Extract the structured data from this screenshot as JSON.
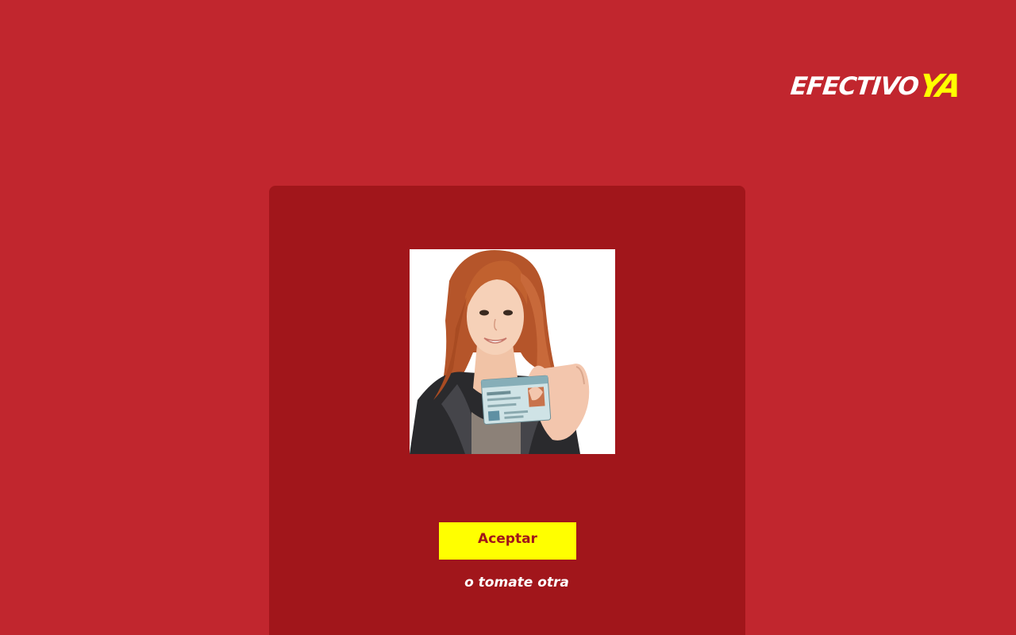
{
  "brand": {
    "logo_main": "EFECTIVO",
    "logo_accent": "YA",
    "background_color": "#c1262e",
    "card_color": "#a1161b",
    "accent_color": "#ffff00"
  },
  "photo": {
    "alt": "woman holding identity card",
    "icon": "id-photo"
  },
  "actions": {
    "accept_label": "Aceptar",
    "retake_label": "o tomate otra"
  }
}
